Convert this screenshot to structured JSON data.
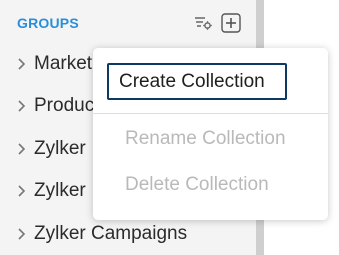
{
  "sidebar": {
    "header": "GROUPS",
    "icons": {
      "filter": "filter-settings-icon",
      "add": "plus-square-icon"
    },
    "items": [
      {
        "label": "Market",
        "icon": "chevron-right-icon"
      },
      {
        "label": "Produc",
        "icon": "chevron-right-icon"
      },
      {
        "label": "Zylker",
        "icon": "chevron-right-icon"
      },
      {
        "label": "Zylker",
        "icon": "chevron-right-icon"
      },
      {
        "label": "Zylker Campaigns",
        "icon": "chevron-right-icon"
      }
    ]
  },
  "context_menu": {
    "items": [
      {
        "label": "Create Collection",
        "enabled": true
      },
      {
        "label": "Rename Collection",
        "enabled": false
      },
      {
        "label": "Delete Collection",
        "enabled": false
      }
    ]
  },
  "colors": {
    "header_accent": "#2a8fd8",
    "focus_border": "#0d3a63",
    "disabled_text": "#b9b9b9"
  }
}
